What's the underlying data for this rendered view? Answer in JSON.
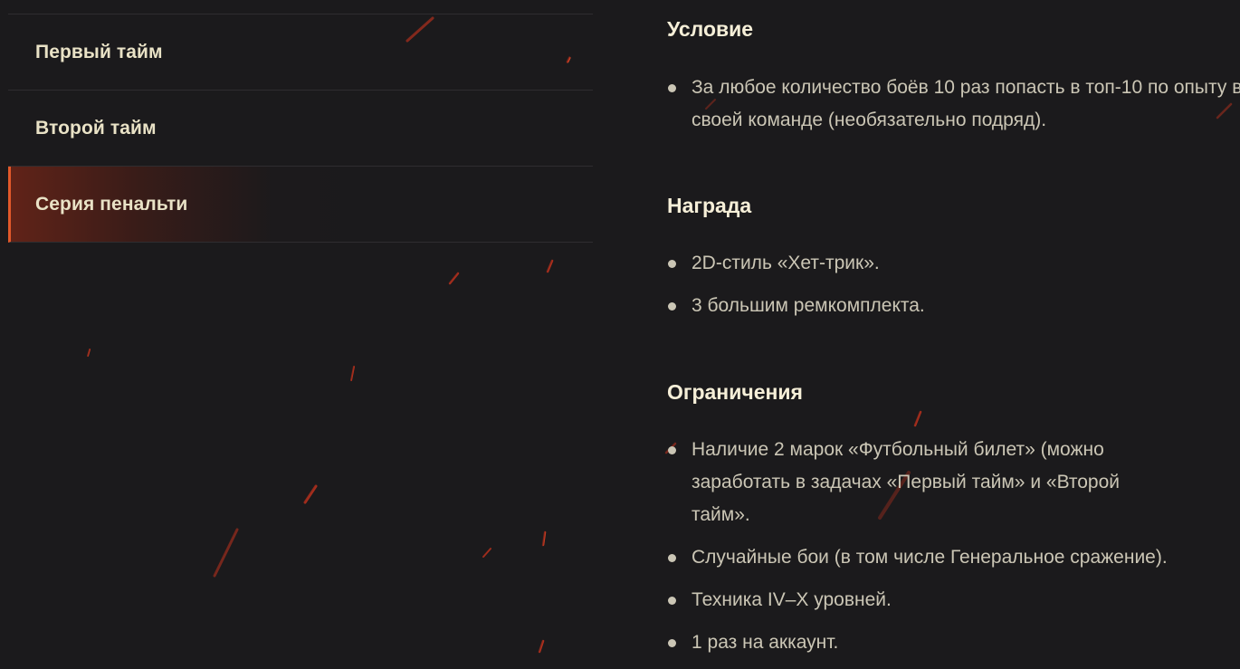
{
  "tabs": [
    {
      "label": "Первый тайм",
      "active": false
    },
    {
      "label": "Второй тайм",
      "active": false
    },
    {
      "label": "Серия пенальти",
      "active": true
    }
  ],
  "condition": {
    "title": "Условие",
    "items": [
      "За любое количество боёв 10 раз попасть в топ-10 по опыту в своей команде (необязательно подряд)."
    ]
  },
  "reward": {
    "title": "Награда",
    "items": [
      "2D-стиль «Хет-трик».",
      "3 большим ремкомплекта."
    ]
  },
  "restrictions": {
    "title": "Ограничения",
    "items": [
      "Наличие 2 марок «Футбольный билет» (можно заработать в задачах «Первый тайм» и «Второй тайм».",
      "Случайные бои (в том числе Генеральное сражение).",
      "Техника IV–X уровней.",
      "1 раз на аккаунт."
    ]
  },
  "colors": {
    "background": "#1b1a1c",
    "accent": "#e2582a",
    "tab_text": "#e9e2c6",
    "heading_text": "#f6efd8",
    "body_text": "#cbc6b5",
    "ember": "#d0331c"
  }
}
